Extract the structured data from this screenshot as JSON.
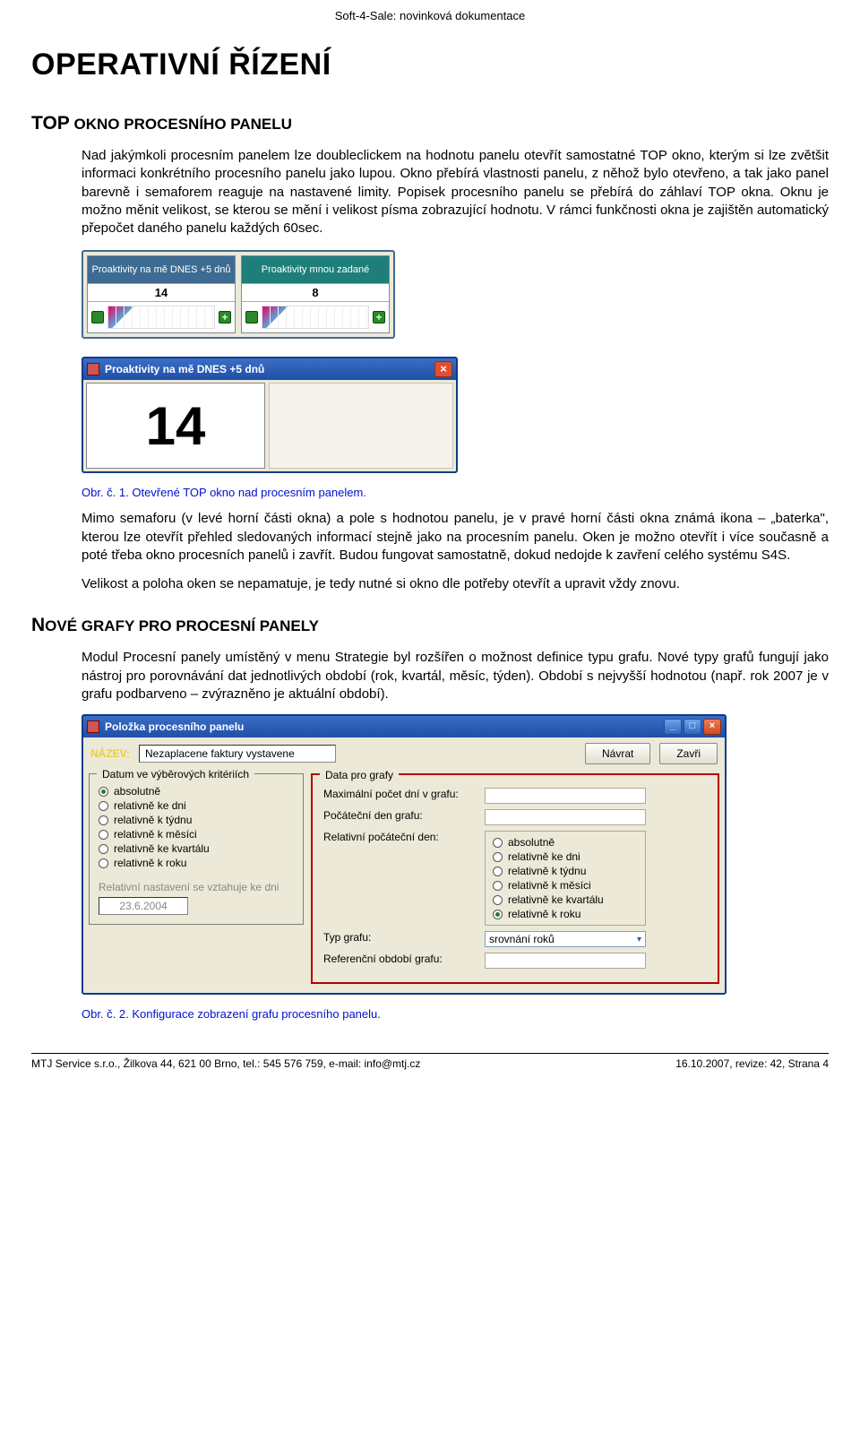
{
  "doc_header": "Soft-4-Sale: novinková dokumentace",
  "h1": "OPERATIVNÍ ŘÍZENÍ",
  "sec1": {
    "heading_large": "TOP",
    "heading_rest": " OKNO PROCESNÍHO PANELU",
    "p1": "Nad jakýmkoli procesním panelem lze doubleclickem na hodnotu panelu otevřít samostatné TOP okno, kterým si lze zvětšit informaci konkrétního procesního panelu jako lupou. Okno přebírá vlastnosti panelu, z něhož bylo otevřeno, a tak jako panel barevně i semaforem reaguje na nastavené limity. Popisek procesního panelu se přebírá do záhlaví TOP okna. Oknu je možno měnit velikost, se kterou se mění i velikost písma zobrazující hodnotu. V rámci funkčnosti okna je zajištěn automatický přepočet daného panelu každých 60sec.",
    "fig1": {
      "panel_a_title": "Proaktivity na mě DNES +5 dnů",
      "panel_a_value": "14",
      "panel_b_title": "Proaktivity mnou zadané",
      "panel_b_value": "8",
      "top_window_title": "Proaktivity na mě DNES +5 dnů",
      "top_window_value": "14"
    },
    "caption1": "Obr. č. 1. Otevřené TOP okno nad procesním panelem.",
    "p2": "Mimo semaforu (v levé horní části okna) a pole s hodnotou panelu, je v pravé horní části okna známá ikona – „baterka\", kterou lze otevřít přehled sledovaných informací stejně jako na procesním panelu. Oken je možno otevřít i více současně a poté třeba okno procesních panelů i zavřít. Budou fungovat samostatně, dokud nedojde k zavření celého systému S4S.",
    "p3": "Velikost a poloha oken se nepamatuje, je tedy nutné si okno dle potřeby otevřít a upravit vždy znovu."
  },
  "sec2": {
    "heading_large": "N",
    "heading_rest": "OVÉ GRAFY PRO PROCESNÍ PANELY",
    "p1": "Modul Procesní panely umístěný v menu Strategie byl rozšířen o možnost definice typu grafu. Nové typy grafů fungují jako nástroj pro porovnávání dat jednotlivých období (rok, kvartál, měsíc, týden). Období s nejvyšší hodnotou (např. rok 2007 je v grafu podbarveno – zvýrazněno je aktuální období).",
    "fig2": {
      "window_title": "Položka procesního panelu",
      "name_label": "NÁZEV:",
      "name_value": "Nezaplacene faktury vystavene",
      "btn_return": "Návrat",
      "btn_close": "Zavři",
      "left_group_title": "Datum ve výběrových kritériích",
      "left_radios": [
        {
          "label": "absolutně",
          "selected": true
        },
        {
          "label": "relativně ke dni",
          "selected": false
        },
        {
          "label": "relativně k týdnu",
          "selected": false
        },
        {
          "label": "relativně k měsíci",
          "selected": false
        },
        {
          "label": "relativně ke kvartálu",
          "selected": false
        },
        {
          "label": "relativně k roku",
          "selected": false
        }
      ],
      "rel_note": "Relativní nastavení se vztahuje ke dni",
      "rel_date": "23.6.2004",
      "right_group_title": "Data pro grafy",
      "row_max_days": "Maximální počet dní v grafu:",
      "row_start_day": "Počáteční den grafu:",
      "row_rel_start": "Relativní počáteční den:",
      "right_radios": [
        {
          "label": "absolutně",
          "selected": false
        },
        {
          "label": "relativně ke dni",
          "selected": false
        },
        {
          "label": "relativně k týdnu",
          "selected": false
        },
        {
          "label": "relativně k měsíci",
          "selected": false
        },
        {
          "label": "relativně ke kvartálu",
          "selected": false
        },
        {
          "label": "relativně k roku",
          "selected": true
        }
      ],
      "row_chart_type": "Typ grafu:",
      "combo_value": "srovnání roků",
      "row_ref_period": "Referenční období grafu:"
    },
    "caption2": "Obr. č. 2. Konfigurace zobrazení grafu procesního panelu."
  },
  "footer": {
    "left": "MTJ Service s.r.o., Žilkova 44, 621 00 Brno, tel.: 545 576 759, e-mail: info@mtj.cz",
    "right": "16.10.2007, revize: 42, Strana 4"
  }
}
